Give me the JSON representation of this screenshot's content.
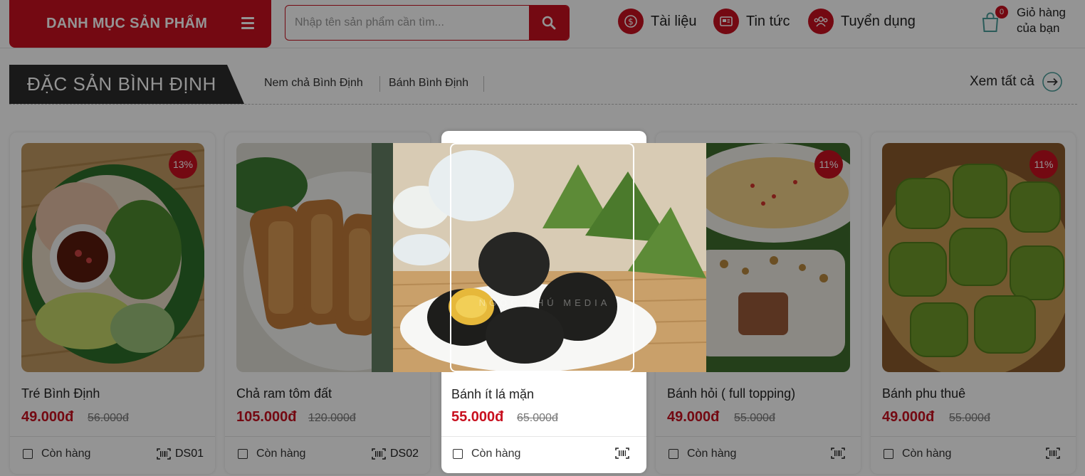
{
  "header": {
    "category_label": "DANH MỤC SẢN PHẨM",
    "search_placeholder": "Nhập tên sản phẩm cần tìm...",
    "nav": [
      {
        "label": "Tài liệu",
        "icon": "dollar-doc-icon"
      },
      {
        "label": "Tin tức",
        "icon": "newspaper-icon"
      },
      {
        "label": "Tuyển dụng",
        "icon": "people-icon"
      }
    ],
    "cart": {
      "count": "0",
      "line1": "Giỏ hàng",
      "line2": "của bạn"
    }
  },
  "section": {
    "title": "ĐẶC SẢN BÌNH ĐỊNH",
    "subcategories": [
      "Nem chả Bình Định",
      "Bánh Bình Định"
    ],
    "view_all": "Xem tất cả"
  },
  "products": [
    {
      "name": "Tré Bình Định",
      "price": "49.000đ",
      "old_price": "56.000đ",
      "discount": "13%",
      "stock": "Còn hàng",
      "code": "DS01"
    },
    {
      "name": "Chả ram tôm đất",
      "price": "105.000đ",
      "old_price": "120.000đ",
      "discount": "",
      "stock": "Còn hàng",
      "code": "DS02"
    },
    {
      "name": "Bánh ít lá mặn",
      "price": "55.000đ",
      "old_price": "65.000đ",
      "discount": "",
      "stock": "Còn hàng",
      "code": ""
    },
    {
      "name": "Bánh hỏi ( full topping)",
      "price": "49.000đ",
      "old_price": "55.000đ",
      "discount": "11%",
      "stock": "Còn hàng",
      "code": ""
    },
    {
      "name": "Bánh phu thuê",
      "price": "49.000đ",
      "old_price": "55.000đ",
      "discount": "11%",
      "stock": "Còn hàng",
      "code": ""
    }
  ],
  "popup": {
    "watermark": "NGỌC PHÚ MEDIA"
  },
  "colors": {
    "brand_red": "#c8101f",
    "dark": "#2b2b2b"
  }
}
